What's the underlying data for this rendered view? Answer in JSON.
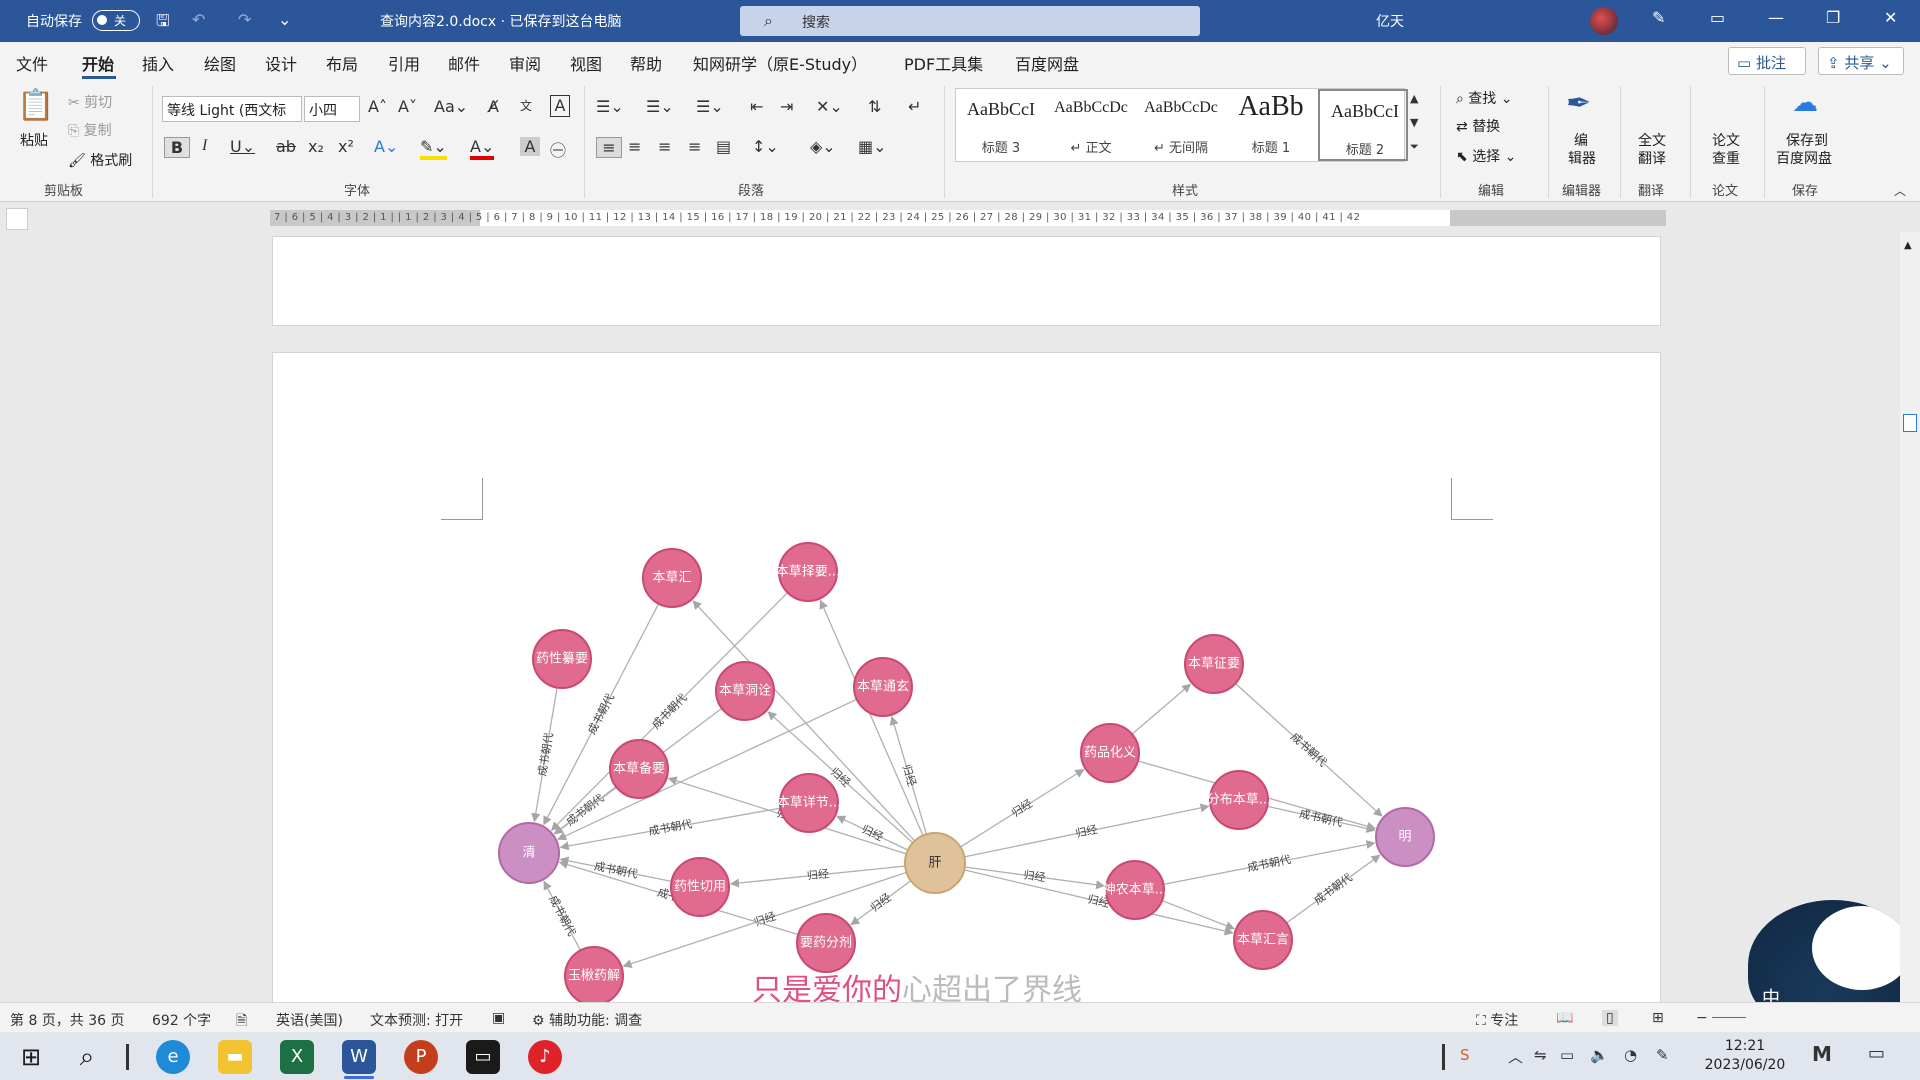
{
  "titlebar": {
    "autosave_label": "自动保存",
    "autosave_state": "关",
    "doc_title": "查询内容2.0.docx · 已保存到这台电脑",
    "search_placeholder": "搜索",
    "user_name": "亿天"
  },
  "menu": {
    "items": [
      "文件",
      "开始",
      "插入",
      "绘图",
      "设计",
      "布局",
      "引用",
      "邮件",
      "审阅",
      "视图",
      "帮助",
      "知网研学（原E-Study）",
      "PDF工具集",
      "百度网盘"
    ],
    "comment": "批注",
    "share": "共享"
  },
  "ribbon": {
    "clipboard": {
      "paste": "粘贴",
      "cut": "剪切",
      "copy": "复制",
      "format_painter": "格式刷",
      "group": "剪贴板"
    },
    "font": {
      "name": "等线 Light (西文标",
      "size": "小四",
      "group": "字体"
    },
    "paragraph": {
      "group": "段落"
    },
    "styles": {
      "group": "样式",
      "items": [
        {
          "preview": "AaBbCcI",
          "name": "标题 3"
        },
        {
          "preview": "AaBbCcDc",
          "name": "↵ 正文"
        },
        {
          "preview": "AaBbCcDc",
          "name": "↵ 无间隔"
        },
        {
          "preview": "AaBb",
          "name": "标题 1"
        },
        {
          "preview": "AaBbCcI",
          "name": "标题 2"
        }
      ]
    },
    "editing": {
      "find": "查找",
      "replace": "替换",
      "select": "选择",
      "group": "编辑"
    },
    "editor": {
      "label1": "编",
      "label2": "辑器",
      "group": "编辑器"
    },
    "translate": {
      "label1": "全文",
      "label2": "翻译",
      "group": "翻译"
    },
    "thesis": {
      "label1": "论文",
      "label2": "查重",
      "group": "论文"
    },
    "save": {
      "label1": "保存到",
      "label2": "百度网盘",
      "group": "保存"
    }
  },
  "ruler": {
    "text": "7 | 6 | 5 | 4 | 3 | 2 | 1 |    | 1 | 2 | 3 | 4 | 5 | 6 | 7 | 8 | 9 | 10 | 11 | 12 | 13 | 14 | 15 | 16 | 17 | 18 | 19 | 20 | 21 | 22 | 23 | 24 | 25 | 26 | 27 | 28 | 29 | 30 | 31 | 32 | 33 | 34 | 35 | 36 | 37 | 38 | 39 | 40 | 41 | 42"
  },
  "graph": {
    "nodes": [
      {
        "id": "gan",
        "label": "肝",
        "type": "center"
      },
      {
        "id": "qing",
        "label": "清",
        "type": "dynasty"
      },
      {
        "id": "ming",
        "label": "明",
        "type": "dynasty"
      },
      {
        "id": "bch",
        "label": "本草汇",
        "type": "book"
      },
      {
        "id": "bczy",
        "label": "本草择要...",
        "type": "book"
      },
      {
        "id": "xxcy",
        "label": "药性纂要",
        "type": "book"
      },
      {
        "id": "bcdq",
        "label": "本草洞诠",
        "type": "book"
      },
      {
        "id": "bctx",
        "label": "本草通玄",
        "type": "book"
      },
      {
        "id": "bcby",
        "label": "本草备要",
        "type": "book"
      },
      {
        "id": "bcxj",
        "label": "本草详节...",
        "type": "book"
      },
      {
        "id": "xxqy",
        "label": "药性切用",
        "type": "book"
      },
      {
        "id": "yyfj",
        "label": "要药分剂",
        "type": "book"
      },
      {
        "id": "ysyj",
        "label": "玉楸药解",
        "type": "book"
      },
      {
        "id": "bczhy",
        "label": "本草征要",
        "type": "book"
      },
      {
        "id": "ypzy",
        "label": "药品化义",
        "type": "book"
      },
      {
        "id": "fbbc",
        "label": "分布本草...",
        "type": "book"
      },
      {
        "id": "snbc",
        "label": "神农本草...",
        "type": "book"
      },
      {
        "id": "bchy",
        "label": "本草汇言",
        "type": "book"
      }
    ],
    "edges": [
      {
        "from": "gan",
        "to": "bch",
        "label": ""
      },
      {
        "from": "gan",
        "to": "bczy",
        "label": ""
      },
      {
        "from": "gan",
        "to": "bcdq",
        "label": "归经"
      },
      {
        "from": "gan",
        "to": "bctx",
        "label": "归经"
      },
      {
        "from": "gan",
        "to": "bcby",
        "label": "归经"
      },
      {
        "from": "gan",
        "to": "bcxj",
        "label": "归经"
      },
      {
        "from": "gan",
        "to": "xxqy",
        "label": "归经"
      },
      {
        "from": "gan",
        "to": "yyfj",
        "label": "归经"
      },
      {
        "from": "gan",
        "to": "ysyj",
        "label": "归经"
      },
      {
        "from": "gan",
        "to": "ypzy",
        "label": "归经"
      },
      {
        "from": "gan",
        "to": "fbbc",
        "label": "归经"
      },
      {
        "from": "gan",
        "to": "snbc",
        "label": "归经"
      },
      {
        "from": "gan",
        "to": "bchy",
        "label": "归经"
      },
      {
        "from": "bch",
        "to": "qing",
        "label": "成书朝代"
      },
      {
        "from": "bczy",
        "to": "qing",
        "label": "成书朝代"
      },
      {
        "from": "xxcy",
        "to": "qing",
        "label": "成书朝代"
      },
      {
        "from": "bcby",
        "to": "qing",
        "label": "成书朝代"
      },
      {
        "from": "bctx",
        "to": "qing",
        "label": ""
      },
      {
        "from": "bcxj",
        "to": "qing",
        "label": "成书朝代"
      },
      {
        "from": "xxqy",
        "to": "qing",
        "label": "成书朝代"
      },
      {
        "from": "yyfj",
        "to": "qing",
        "label": "成书朝代"
      },
      {
        "from": "ysyj",
        "to": "qing",
        "label": "成书朝代"
      },
      {
        "from": "bcdq",
        "to": "qing",
        "label": "成书朝代"
      },
      {
        "from": "bczhy",
        "to": "ming",
        "label": "成书朝代"
      },
      {
        "from": "ypzy",
        "to": "bczhy",
        "label": ""
      },
      {
        "from": "ypzy",
        "to": "ming",
        "label": ""
      },
      {
        "from": "fbbc",
        "to": "ming",
        "label": "成书朝代"
      },
      {
        "from": "snbc",
        "to": "ming",
        "label": "成书朝代"
      },
      {
        "from": "bchy",
        "to": "ming",
        "label": "成书朝代"
      },
      {
        "from": "snbc",
        "to": "bchy",
        "label": ""
      }
    ]
  },
  "lyric": {
    "highlight": "只是爱你的",
    "rest": "心超出了界线"
  },
  "mascot_text": "中",
  "status": {
    "page": "第 8 页，共 36 页",
    "words": "692 个字",
    "lang": "英语(美国)",
    "predict": "文本预测: 打开",
    "access": "辅助功能: 调查",
    "focus": "专注"
  },
  "clock": {
    "time": "12:21",
    "date": "2023/06/20"
  },
  "colors": {
    "accent": "#2b579a",
    "book_node": "#e06b8f",
    "dynasty_node": "#cc8fc4",
    "center_node": "#dfc299"
  }
}
